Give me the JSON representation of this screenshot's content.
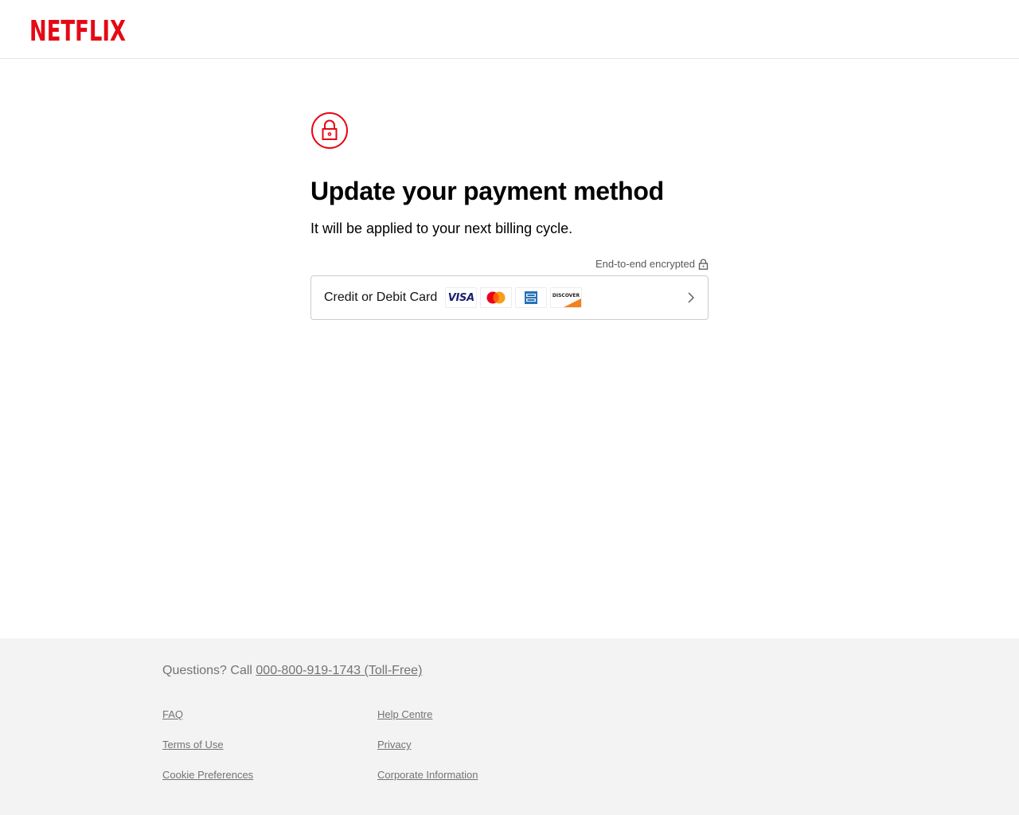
{
  "header": {
    "logo_text": "NETFLIX",
    "logo_color": "#e50914"
  },
  "main": {
    "icon": "lock-icon",
    "title": "Update your payment method",
    "subtitle": "It will be applied to your next billing cycle.",
    "encrypted_label": "End-to-end encrypted",
    "payment_option": {
      "label": "Credit or Debit Card",
      "card_logos": [
        "visa-logo",
        "mastercard-logo",
        "amex-logo",
        "discover-logo"
      ],
      "visa_text": "VISA",
      "discover_text": "DISCOVER"
    }
  },
  "footer": {
    "questions_prefix": "Questions? Call",
    "phone": "000-800-919-1743 (Toll-Free)",
    "links": {
      "faq": "FAQ",
      "help_centre": "Help Centre",
      "terms": "Terms of Use",
      "privacy": "Privacy",
      "cookie": "Cookie Preferences",
      "corporate": "Corporate Information"
    }
  },
  "colors": {
    "accent": "#e50914",
    "footer_bg": "#f3f3f3",
    "footer_text": "#737373"
  }
}
